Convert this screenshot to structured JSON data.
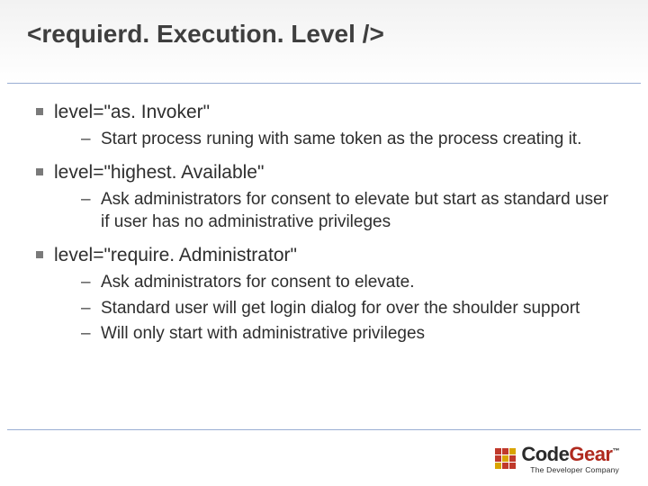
{
  "title": "<requierd. Execution. Level />",
  "bullets": [
    {
      "label": "level=\"as. Invoker\"",
      "sub": [
        "Start process runing with same token as the process creating it."
      ]
    },
    {
      "label": "level=\"highest. Available\"",
      "sub": [
        "Ask administrators for consent to elevate but start as standard user if user has no administrative privileges"
      ]
    },
    {
      "label": "level=\"require. Administrator\"",
      "sub": [
        "Ask administrators for consent to elevate.",
        "Standard user will get login dialog for over the shoulder support",
        "Will only start with administrative privileges"
      ]
    }
  ],
  "logo": {
    "code": "Code",
    "gear": "Gear",
    "tm": "™",
    "sub": "The Developer Company"
  }
}
